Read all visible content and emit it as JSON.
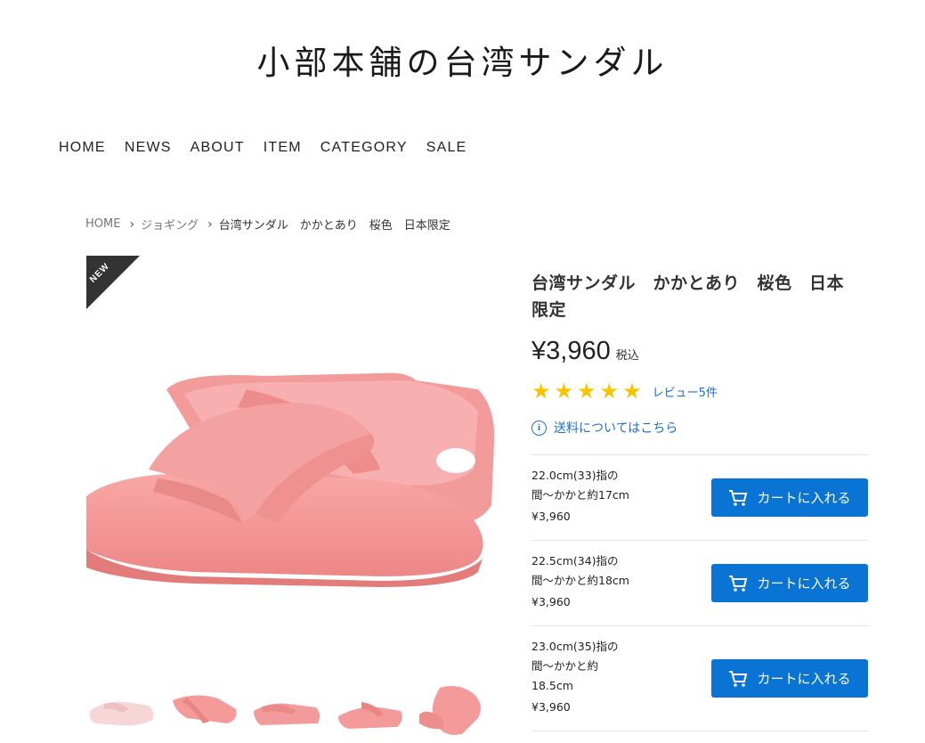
{
  "site": {
    "title": "小部本舗の台湾サンダル"
  },
  "nav": [
    "HOME",
    "NEWS",
    "ABOUT",
    "ITEM",
    "CATEGORY",
    "SALE"
  ],
  "breadcrumb": {
    "home": "HOME",
    "category": "ジョギング",
    "current": "台湾サンダル　かかとあり　桜色　日本限定"
  },
  "product": {
    "badge": "NEW",
    "title": "台湾サンダル　かかとあり　桜色　日本限定",
    "price": "¥3,960",
    "tax_label": "税込",
    "rating": 5,
    "review_link": "レビュー5件",
    "shipping_link": "送料についてはこちら"
  },
  "variants": [
    {
      "size_line1": "22.0cm(33)指の",
      "size_line2": "間～かかと約17cm",
      "size_line3": "",
      "price": "¥3,960",
      "button": "カートに入れる"
    },
    {
      "size_line1": "22.5cm(34)指の",
      "size_line2": "間～かかと約18cm",
      "size_line3": "",
      "price": "¥3,960",
      "button": "カートに入れる"
    },
    {
      "size_line1": "23.0cm(35)指の",
      "size_line2": "間～かかと約",
      "size_line3": "18.5cm",
      "price": "¥3,960",
      "button": "カートに入れる"
    }
  ],
  "colors": {
    "accent": "#0a74d4",
    "link": "#1d6fd0",
    "star": "#f6c500",
    "sandal": "#f59a9a"
  }
}
